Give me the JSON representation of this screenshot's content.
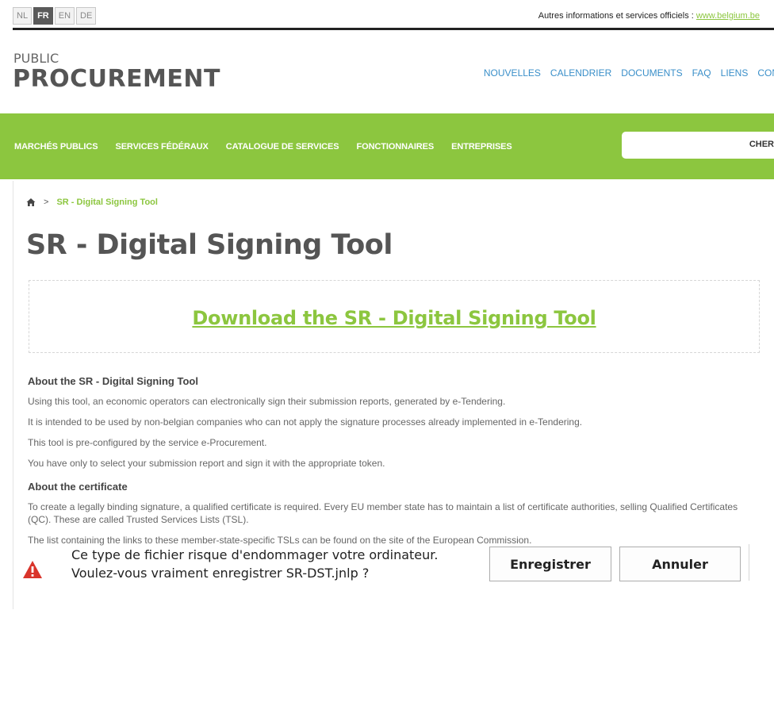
{
  "header": {
    "languages": [
      {
        "code": "NL",
        "active": false
      },
      {
        "code": "FR",
        "active": true
      },
      {
        "code": "EN",
        "active": false
      },
      {
        "code": "DE",
        "active": false
      }
    ],
    "official_text": "Autres informations et services officiels : ",
    "official_link": "www.belgium.be"
  },
  "logo": {
    "line1": "PUBLIC",
    "line2": "PROCUREMENT"
  },
  "topnav": [
    "NOUVELLES",
    "CALENDRIER",
    "DOCUMENTS",
    "FAQ",
    "LIENS",
    "CON"
  ],
  "mainnav": [
    "MARCHÉS PUBLICS",
    "SERVICES FÉDÉRAUX",
    "CATALOGUE DE SERVICES",
    "FONCTIONNAIRES",
    "ENTREPRISES"
  ],
  "search": {
    "button": "CHER",
    "placeholder": ""
  },
  "breadcrumb": {
    "separator": ">",
    "current": "SR - Digital Signing Tool"
  },
  "page": {
    "title": "SR - Digital Signing Tool",
    "download_link": "Download the SR - Digital Signing Tool",
    "section1": {
      "heading": "About the SR - Digital Signing Tool",
      "paragraphs": [
        "Using this tool, an economic operators can electronically sign their submission reports, generated by e-Tendering.",
        "It is intended to be used by non-belgian companies who can not apply the signature processes already implemented in e-Tendering.",
        "This tool is pre-configured by the service e-Procurement.",
        "You have only to select your submission report and sign it with the appropriate token."
      ]
    },
    "section2": {
      "heading": "About the certificate",
      "paragraphs": [
        "To create a legally binding signature, a qualified certificate is required. Every EU member state has to maintain a list of certificate authorities, selling Qualified Certificates (QC). These are called Trusted Services Lists (TSL).",
        "The list containing the links to these member-state-specific TSLs can be found on the site of the European Commission."
      ]
    }
  },
  "download_bar": {
    "line1": "Ce type de fichier risque d'endommager votre ordinateur.",
    "line2": "Voulez-vous vraiment enregistrer SR-DST.jnlp ?",
    "save_label": "Enregistrer",
    "cancel_label": "Annuler",
    "icon": "warning-icon",
    "icon_color": "#d9342b"
  },
  "colors": {
    "accent_green": "#8cc63f",
    "link_blue": "#3a8fc9"
  }
}
